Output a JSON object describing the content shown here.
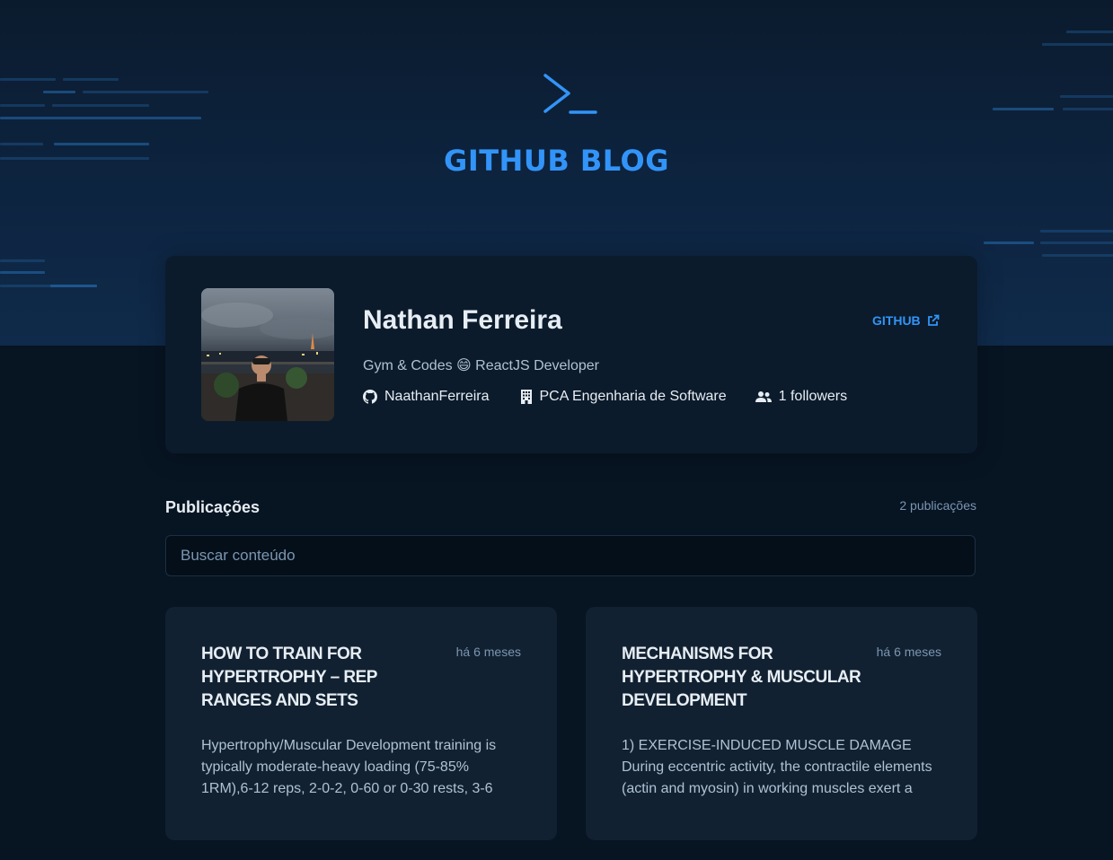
{
  "header": {
    "brand": "GITHUB BLOG",
    "logo_icon": "terminal-prompt-icon"
  },
  "profile": {
    "name": "Nathan Ferreira",
    "github_link_label": "GITHUB",
    "bio": "Gym & Codes 😄 ReactJS Developer",
    "username": "NaathanFerreira",
    "company": "PCA Engenharia de Software",
    "followers": "1 followers",
    "icons": [
      "github-icon",
      "building-icon",
      "users-icon",
      "external-link-icon"
    ]
  },
  "publications": {
    "title": "Publicações",
    "count": "2 publicações",
    "search_placeholder": "Buscar conteúdo"
  },
  "posts": [
    {
      "title": "HOW TO TRAIN FOR HYPERTROPHY – REP RANGES AND SETS",
      "ago": "há 6 meses",
      "excerpt": "Hypertrophy/Muscular Development training is typically moderate-heavy loading (75-85% 1RM),6-12 reps, 2-0-2, 0-60 or 0-30 rests, 3-6"
    },
    {
      "title": "MECHANISMS FOR HYPERTROPHY & MUSCULAR DEVELOPMENT",
      "ago": "há 6 meses",
      "excerpt": "1) EXERCISE-INDUCED MUSCLE DAMAGE During eccentric activity, the contractile elements (actin and myosin) in working muscles exert a"
    }
  ],
  "colors": {
    "accent": "#3294f8",
    "background": "#071422",
    "card": "#112131",
    "profile_card": "#0b1b2b"
  }
}
